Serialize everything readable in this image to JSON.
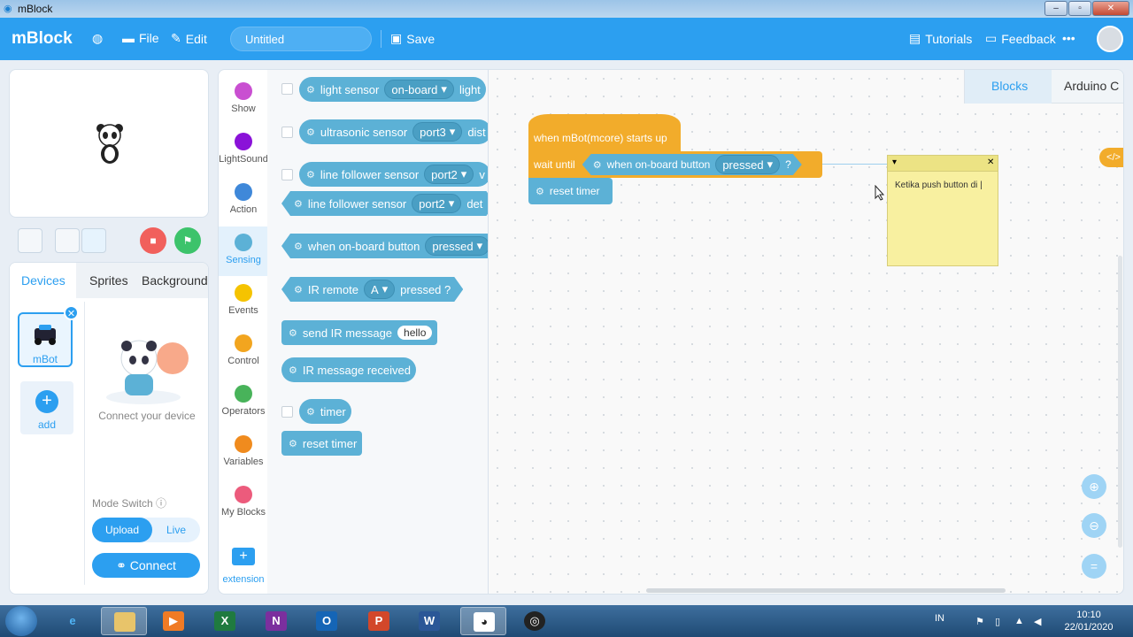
{
  "window": {
    "title": "mBlock"
  },
  "header": {
    "logo": "mBlock",
    "file": "File",
    "edit": "Edit",
    "project_name": "Untitled",
    "save": "Save",
    "tutorials": "Tutorials",
    "feedback": "Feedback",
    "more": "•••"
  },
  "devices_panel": {
    "tabs": [
      "Devices",
      "Sprites",
      "Background"
    ],
    "device_name": "mBot",
    "add_label": "add",
    "connect_text": "Connect your device",
    "mode_switch_label": "Mode Switch",
    "mode_upload": "Upload",
    "mode_live": "Live",
    "connect_button": "Connect"
  },
  "categories": [
    {
      "label": "Show",
      "color": "#c94fd1"
    },
    {
      "label": "LightSound",
      "color": "#8a12d8"
    },
    {
      "label": "Action",
      "color": "#3f88d9"
    },
    {
      "label": "Sensing",
      "color": "#5cb1d6"
    },
    {
      "label": "Events",
      "color": "#f5c300"
    },
    {
      "label": "Control",
      "color": "#f2a51f"
    },
    {
      "label": "Operators",
      "color": "#48b35a"
    },
    {
      "label": "Variables",
      "color": "#f08b1e"
    },
    {
      "label": "My Blocks",
      "color": "#ec5b7c"
    }
  ],
  "extension_label": "extension",
  "palette": {
    "light_sensor": {
      "label": "light sensor",
      "dropdown": "on-board",
      "tail": "light"
    },
    "ultrasonic": {
      "label": "ultrasonic sensor",
      "dropdown": "port3",
      "tail": "dist"
    },
    "line_follower_1": {
      "label": "line follower sensor",
      "dropdown": "port2",
      "tail": "v"
    },
    "line_follower_2": {
      "label": "line follower sensor",
      "dropdown": "port2",
      "tail": "det"
    },
    "onboard_button": {
      "label": "when on-board button",
      "dropdown": "pressed"
    },
    "ir_remote": {
      "label": "IR remote",
      "dropdown": "A",
      "tail": "pressed ?"
    },
    "send_ir": {
      "label": "send IR message",
      "value": "hello"
    },
    "ir_received": {
      "label": "IR message received"
    },
    "timer": {
      "label": "timer"
    },
    "reset_timer": {
      "label": "reset timer"
    }
  },
  "canvas": {
    "tabs": [
      "Blocks",
      "Arduino C"
    ],
    "hat_block": "when mBot(mcore) starts up",
    "wait_until": "wait until",
    "condition_label": "when on-board button",
    "condition_dropdown": "pressed",
    "condition_tail": "?",
    "reset_timer": "reset timer",
    "note_text": "Ketika push button di |",
    "code_toggle": "</>"
  },
  "taskbar": {
    "apps": [
      "Internet Explorer",
      "File Explorer",
      "Media",
      "Excel",
      "OneNote",
      "Outlook",
      "PowerPoint",
      "Word",
      "mBlock",
      "OBS"
    ],
    "language": "IN",
    "time": "10:10",
    "date": "22/01/2020"
  }
}
